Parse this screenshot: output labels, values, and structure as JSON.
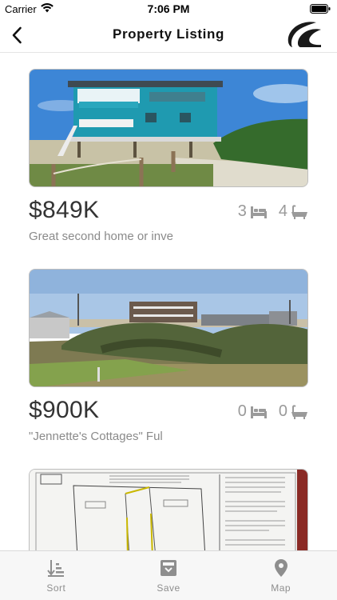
{
  "status_bar": {
    "carrier": "Carrier",
    "time": "7:06 PM"
  },
  "nav": {
    "title": "Property Listing"
  },
  "listings": [
    {
      "price": "$849K",
      "description": "Great second home or inve",
      "beds": "3",
      "baths": "4"
    },
    {
      "price": "$900K",
      "description": "\"Jennette's Cottages\" Ful",
      "beds": "0",
      "baths": "0"
    },
    {
      "price": "",
      "description": "",
      "beds": "",
      "baths": ""
    }
  ],
  "tabs": [
    {
      "label": "Sort",
      "icon": "sort-icon"
    },
    {
      "label": "Save",
      "icon": "save-icon"
    },
    {
      "label": "Map",
      "icon": "map-pin-icon"
    }
  ],
  "colors": {
    "text": "#333333",
    "muted": "#8a8a8a",
    "tab_label": "#8e8e8e",
    "tab_bar_bg": "#f7f7f7"
  }
}
